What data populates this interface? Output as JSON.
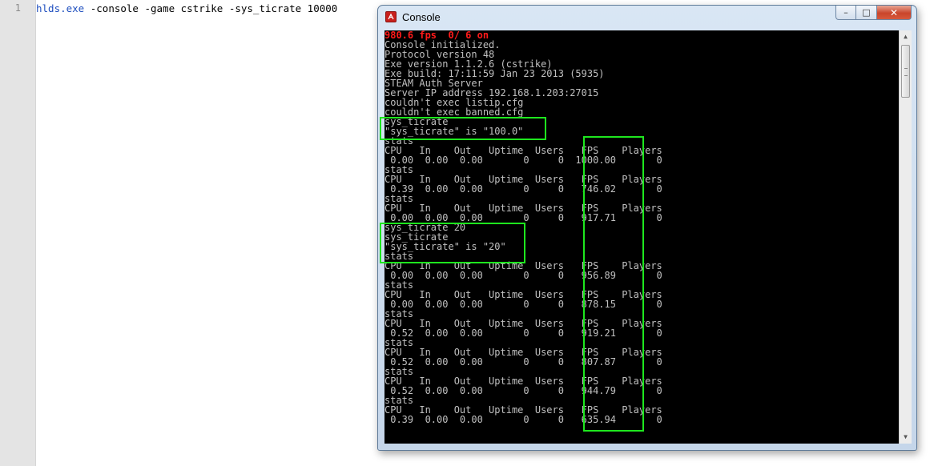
{
  "editor": {
    "line_number": "1",
    "command_exe": "hlds.exe",
    "command_args": " -console -game cstrike -sys_ticrate 10000"
  },
  "console_window": {
    "title": "Console",
    "minimize_label": "–",
    "maximize_label": "□",
    "close_label": "✕",
    "fps_status": "980.6 fps  0/ 6 on",
    "lines": [
      "Console initialized.",
      "Protocol version 48",
      "Exe version 1.1.2.6 (cstrike)",
      "Exe build: 17:11:59 Jan 23 2013 (5935)",
      "STEAM Auth Server",
      "Server IP address 192.168.1.203:27015",
      "couldn't exec listip.cfg",
      "couldn't exec banned.cfg",
      "sys_ticrate",
      "\"sys_ticrate\" is \"100.0\"",
      "stats",
      "CPU   In    Out   Uptime  Users   FPS    Players",
      " 0.00  0.00  0.00       0     0  1000.00       0",
      "stats",
      "CPU   In    Out   Uptime  Users   FPS    Players",
      " 0.39  0.00  0.00       0     0   746.02       0",
      "stats",
      "CPU   In    Out   Uptime  Users   FPS    Players",
      " 0.00  0.00  0.00       0     0   917.71       0",
      "sys_ticrate 20",
      "sys_ticrate",
      "\"sys_ticrate\" is \"20\"",
      "stats",
      "CPU   In    Out   Uptime  Users   FPS    Players",
      " 0.00  0.00  0.00       0     0   956.89       0",
      "stats",
      "CPU   In    Out   Uptime  Users   FPS    Players",
      " 0.00  0.00  0.00       0     0   878.15       0",
      "stats",
      "CPU   In    Out   Uptime  Users   FPS    Players",
      " 0.52  0.00  0.00       0     0   919.21       0",
      "stats",
      "CPU   In    Out   Uptime  Users   FPS    Players",
      " 0.52  0.00  0.00       0     0   807.87       0",
      "stats",
      "CPU   In    Out   Uptime  Users   FPS    Players",
      " 0.52  0.00  0.00       0     0   944.79       0",
      "stats",
      "CPU   In    Out   Uptime  Users   FPS    Players",
      " 0.39  0.00  0.00       0     0   635.94       0"
    ]
  },
  "colors": {
    "highlight": "#1ee61e",
    "fps_status": "#ff1a1a",
    "console_text": "#c0c0c0"
  }
}
